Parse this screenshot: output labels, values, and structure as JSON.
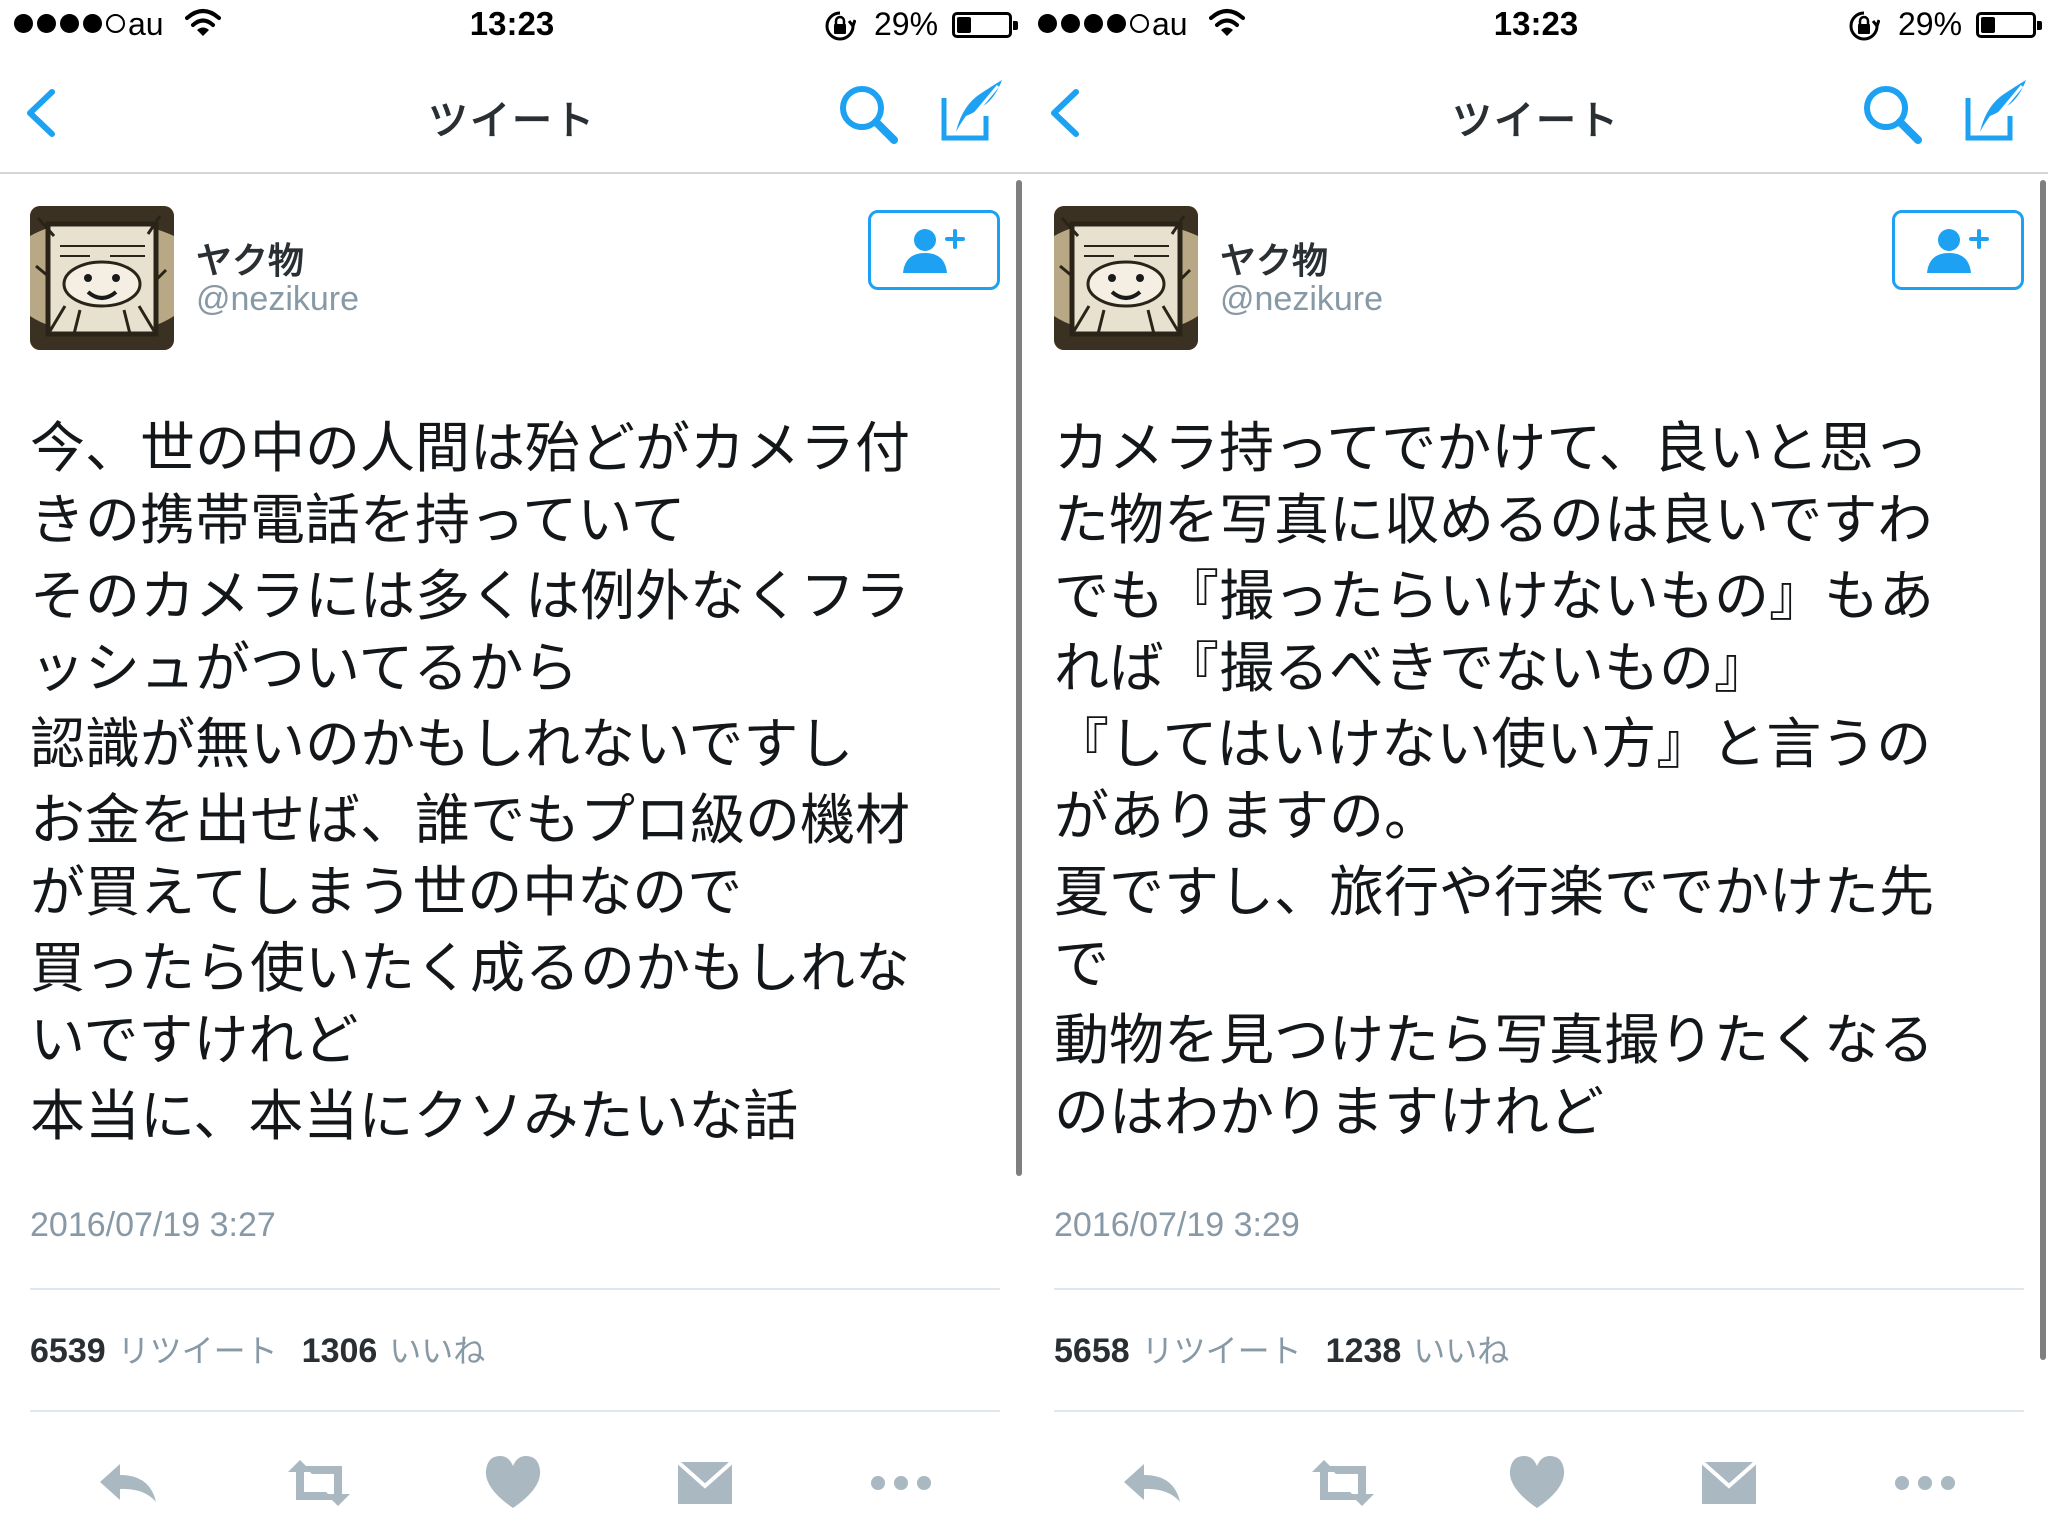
{
  "status_bar": {
    "carrier": "au",
    "time": "13:23",
    "battery_percent": "29%",
    "battery_level": 0.29,
    "signal_bars": 4
  },
  "nav": {
    "title": "ツイート"
  },
  "colors": {
    "accent": "#1da1f2",
    "secondary_text": "#8899a6",
    "action_icon": "#aab8c2"
  },
  "tweets": [
    {
      "name": "ヤク物",
      "handle": "@nezikure",
      "lines": [
        "今、世の中の人間は殆どがカメラ付",
        "きの携帯電話を持っていて",
        "そのカメラには多くは例外なくフラ",
        "ッシュがついてるから",
        "認識が無いのかもしれないですし",
        "お金を出せば、誰でもプロ級の機材",
        "が買えてしまう世の中なので",
        "買ったら使いたく成るのかもしれな",
        "いですけれど",
        "本当に、本当にクソみたいな話"
      ],
      "timestamp": "2016/07/19 3:27",
      "retweet_count": "6539",
      "retweet_label": "リツイート",
      "like_count": "1306",
      "like_label": "いいね"
    },
    {
      "name": "ヤク物",
      "handle": "@nezikure",
      "lines": [
        "カメラ持ってでかけて、良いと思っ",
        "た物を写真に収めるのは良いですわ",
        "でも『撮ったらいけないもの』もあ",
        "れば『撮るべきでないもの』",
        "『してはいけない使い方』と言うの",
        "がありますの。",
        "夏ですし、旅行や行楽ででかけた先",
        "で",
        "動物を見つけたら写真撮りたくなる",
        "のはわかりますけれど"
      ],
      "timestamp": "2016/07/19 3:29",
      "retweet_count": "5658",
      "retweet_label": "リツイート",
      "like_count": "1238",
      "like_label": "いいね"
    }
  ],
  "actions": [
    "reply-icon",
    "retweet-icon",
    "like-icon",
    "message-icon",
    "more-icon"
  ]
}
